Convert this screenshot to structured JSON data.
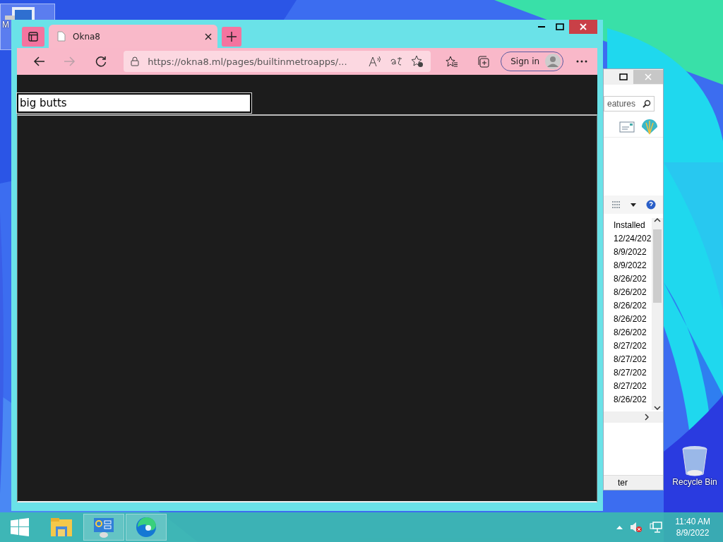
{
  "desktop": {
    "icons": [
      {
        "kind": "computer",
        "label": "M"
      },
      {
        "kind": "recycle-bin",
        "label": "Recycle Bin"
      }
    ]
  },
  "background_window": {
    "search": {
      "value": "eatures"
    },
    "column_header": "Installed",
    "rows": [
      "12/24/202",
      "8/9/2022",
      "8/9/2022",
      "8/26/202",
      "8/26/202",
      "8/26/202",
      "8/26/202",
      "8/26/202",
      "8/27/202",
      "8/27/202",
      "8/27/202",
      "8/27/202",
      "8/26/202"
    ],
    "status_text": "ter"
  },
  "browser": {
    "tabs": [
      {
        "title": "Okna8",
        "selected": true
      }
    ],
    "nav_buttons": [
      {
        "kind": "back",
        "disabled": false
      },
      {
        "kind": "forward",
        "disabled": true
      },
      {
        "kind": "refresh",
        "disabled": false
      }
    ],
    "address": "https://okna8.ml/pages/builtinmetroapps/...",
    "sign_in": "Sign in",
    "page": {
      "input": {
        "value": "big butts"
      }
    }
  },
  "taskbar": {
    "apps": [
      {
        "kind": "explorer",
        "active": false
      },
      {
        "kind": "control-panel",
        "active": true
      },
      {
        "kind": "edge",
        "active": true
      }
    ],
    "clock": {
      "time": "11:40 AM",
      "date": "8/9/2022"
    }
  }
}
